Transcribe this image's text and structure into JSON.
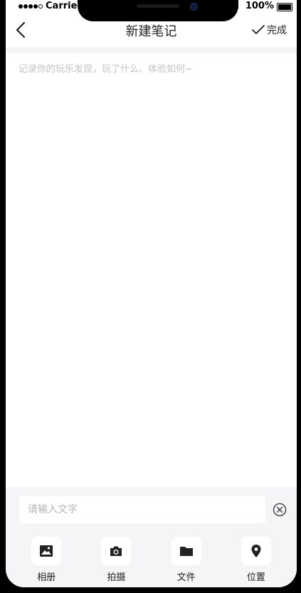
{
  "status_bar": {
    "carrier": "Carrie",
    "battery": "100%"
  },
  "header": {
    "title": "新建笔记",
    "done_label": "完成"
  },
  "editor": {
    "placeholder": "记录你的玩乐发现，玩了什么、体验如何~"
  },
  "input_bar": {
    "placeholder": "请输入文字"
  },
  "toolbar": {
    "items": [
      {
        "label": "相册",
        "icon": "image-icon"
      },
      {
        "label": "拍摄",
        "icon": "camera-icon"
      },
      {
        "label": "文件",
        "icon": "folder-icon"
      },
      {
        "label": "位置",
        "icon": "location-pin-icon"
      }
    ]
  },
  "colors": {
    "background": "#ffffff",
    "panel": "#f5f5f7",
    "text": "#222222",
    "placeholder": "#c2c2c2"
  }
}
